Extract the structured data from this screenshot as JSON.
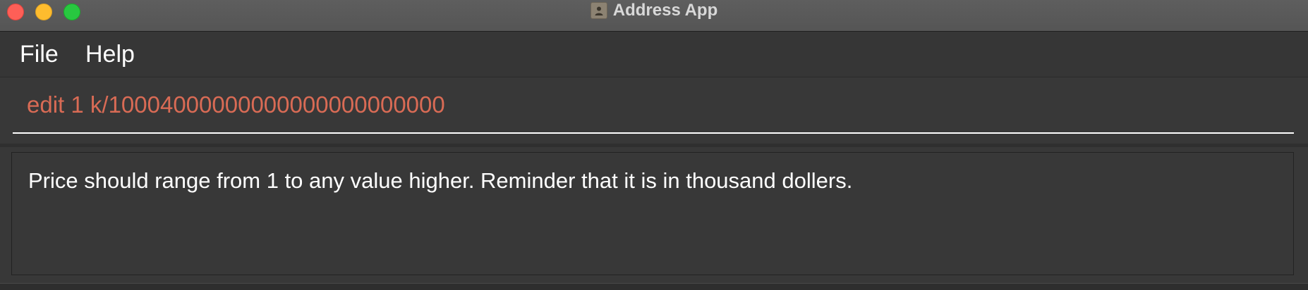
{
  "window": {
    "title": "Address App",
    "app_icon": "address-book-icon"
  },
  "menubar": {
    "items": [
      {
        "label": "File"
      },
      {
        "label": "Help"
      }
    ]
  },
  "command_box": {
    "value": "edit 1 k/10004000000000000000000000",
    "text_color": "#d96b55"
  },
  "result_display": {
    "message": "Price should range from 1 to any value higher. Reminder that it is in thousand dollers."
  },
  "colors": {
    "background": "#3a3a3a",
    "error_text": "#d96b55",
    "close": "#fe5f57",
    "minimize": "#febc2e",
    "maximize": "#28c840"
  }
}
